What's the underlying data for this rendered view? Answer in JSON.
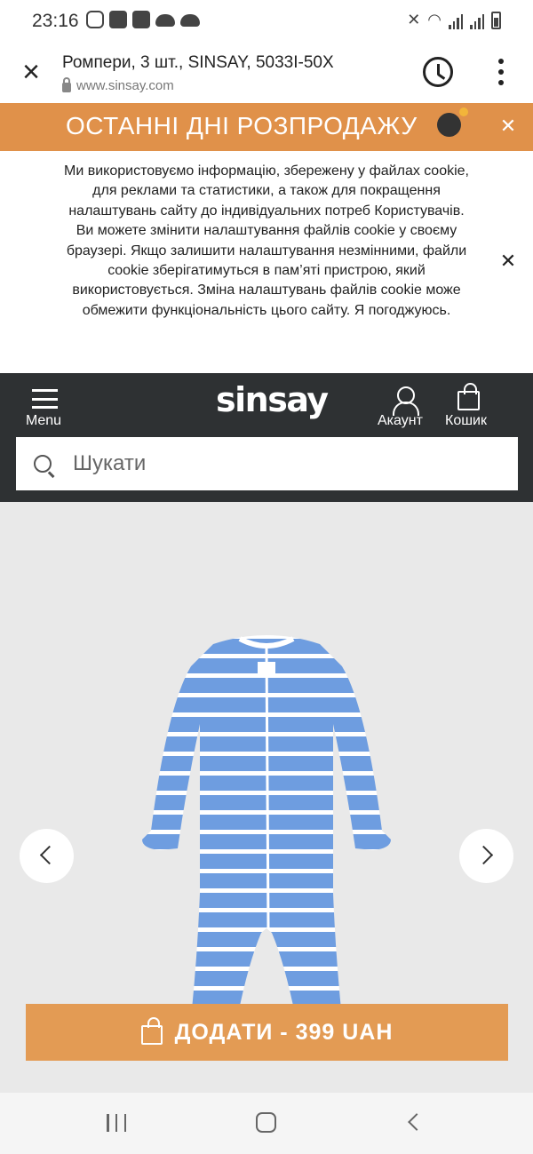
{
  "status_bar": {
    "time": "23:16",
    "icons_left": [
      "instagram-icon",
      "app-icon",
      "app-icon",
      "cloud-up-icon",
      "cloud-icon"
    ],
    "icons_right": [
      "mute-icon",
      "wifi-icon",
      "signal-icon",
      "signal-icon",
      "battery-icon"
    ]
  },
  "browser": {
    "title": "Ромпери, 3 шт., SINSAY, 5033I-50X",
    "url": "www.sinsay.com"
  },
  "promo": {
    "text": "ОСТАННІ ДНІ РОЗПРОДАЖУ",
    "background": "#e0914a"
  },
  "cookie": {
    "text": "Ми використовуємо інформацію, збережену у файлах cookie, для реклами та статистики, а також для покращення налаштувань сайту до індивідуальних потреб Користувачів. Ви можете змінити налаштування файлів cookie у своєму браузері. Якщо залишити налаштування незмінними, файли cookie зберігатимуться в пам’яті пристрою, який використовується. Зміна налаштувань файлів cookie може обмежити функціональність цього сайту. Я погоджуюсь."
  },
  "header": {
    "logo": "sinsay",
    "menu_label": "Menu",
    "account_label": "Акаунт",
    "cart_label": "Кошик",
    "background": "#2e3133"
  },
  "search": {
    "placeholder": "Шукати"
  },
  "product": {
    "image_label": "romper-blue-striped",
    "tag_text": "Sinsay",
    "colors": {
      "body": "#6e9de0",
      "stripe": "#ffffff",
      "background": "#e9e9e9"
    }
  },
  "cta": {
    "label": "ДОДАТИ - 399 UAH",
    "background": "#e39b54"
  }
}
